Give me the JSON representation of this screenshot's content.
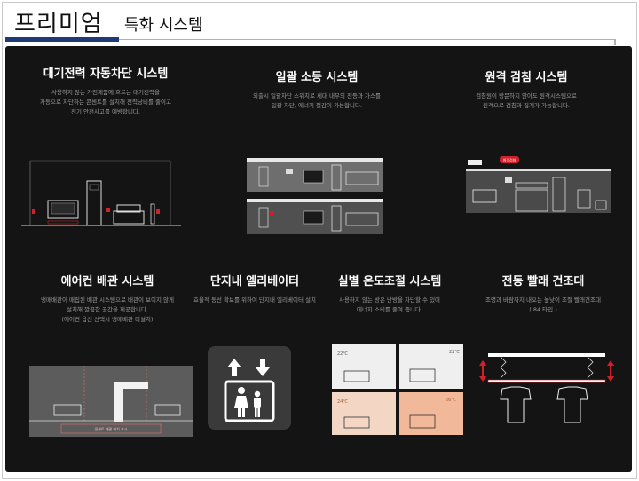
{
  "header": {
    "title": "프리미엄",
    "subtitle": "특화 시스템"
  },
  "features": [
    {
      "title": "대기전력 자동차단 시스템",
      "desc": [
        "사용하지 않는 가전제품에 흐르는 대기전력을",
        "자동으로 차단하는 콘센트를 설치해 전력낭비를 줄이고",
        "전기 안전사고를 예방합니다."
      ]
    },
    {
      "title": "일괄 소등 시스템",
      "desc": [
        "외출시 일괄차단 스위치로 세대 내부의 전등과 가스를",
        "일괄 차단, 에너지 절감이 가능합니다."
      ]
    },
    {
      "title": "원격 검침 시스템",
      "desc": [
        "검침원이 방문하지 않아도 원격시스템으로",
        "원격으로 검침과 집계가 가능합니다."
      ]
    },
    {
      "title": "에어컨 배관 시스템",
      "desc": [
        "냉매배관이 매립된 배관 시스템으로 배관이 보이지 않게",
        "설치해 깔끔한 공간을 제공합니다.",
        "(에어컨 옵션 선택시 냉매배관 미설치)"
      ]
    },
    {
      "title": "단지내 엘리베이터",
      "desc": [
        "효율적 동선 확보를 위하여 단지내 엘리베이터 설치"
      ]
    },
    {
      "title": "실별 온도조절 시스템",
      "desc": [
        "사용하지 않는 방은 난방을 차단할 수 있어",
        "에너지 소비를 줄여 줍니다."
      ]
    },
    {
      "title": "전동 빨래 건조대",
      "desc": [
        "조명과 바람까지 내오는 높낮이 조절 빨래건조대",
        "( 84 타입 )"
      ]
    }
  ],
  "illus_labels": {
    "outlet_caption": "콘센트 배관 위치 표시",
    "temp_a": "22℃",
    "temp_b": "22℃",
    "temp_c": "24℃",
    "temp_d": "26℃",
    "meter_tag": "원격검침"
  },
  "colors": {
    "panel_bg": "#141414",
    "header_accent": "#1f3a77",
    "highlight_red": "#d0202a",
    "warm_room": "#f1b89a"
  }
}
